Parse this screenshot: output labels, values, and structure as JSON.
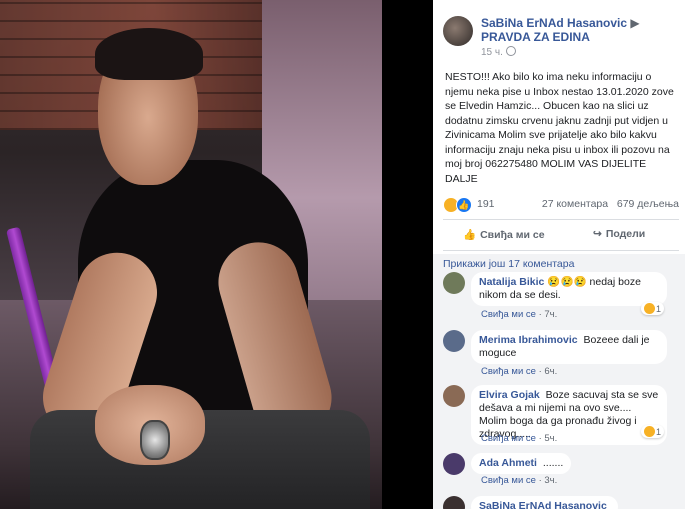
{
  "post": {
    "author": "SaBiNa ErNAd Hasanovic",
    "arrow": "▶",
    "target": "PRAVDA ZA EDINA",
    "time": "15 ч.",
    "text": "NESTO!!! Ako bilo ko ima neku informaciju o njemu neka pise u Inbox nestao 13.01.2020 zove se Elvedin Hamzic... Obucen kao na slici uz dodatnu zimsku crvenu jaknu zadnji put vidjen u Zivinicama Molim sve prijatelje ako bilo kakvu informaciju znaju neka pisu u inbox ili pozovu na moj broj 062275480 MOLIM VAS DIJELITE DALJE"
  },
  "reactions": {
    "count": "191",
    "comments": "27 коментара",
    "shares": "679 дељења"
  },
  "actions": {
    "like": "Свиђа ми се",
    "share": "Подели",
    "like_icon": "thumbs-up-icon",
    "share_icon": "share-arrow-icon"
  },
  "comments_section": {
    "more": "Прикажи још 17 коментара",
    "like_label": "Свиђа ми се",
    "items": [
      {
        "name": "Natalija Bikic",
        "text": "nedaj boze nikom da se desi.",
        "prefix_emoji": "😢😢😢",
        "time": "7ч.",
        "reaction_count": "1",
        "avatar_color": "#6f7a5a"
      },
      {
        "name": "Merima Ibrahimovic",
        "text": "Bozeee dali je moguce",
        "prefix_emoji": "",
        "time": "6ч.",
        "reaction_count": "",
        "avatar_color": "#5a6b8a"
      },
      {
        "name": "Elvira Gojak",
        "text": "Boze sacuvaj sta se sve dešava a mi nijemi na ovo sve.... Molim boga da ga pronađu živog i zdravog.....",
        "prefix_emoji": "",
        "time": "5ч.",
        "reaction_count": "1",
        "avatar_color": "#8a6a55"
      },
      {
        "name": "Ada Ahmeti",
        "text": ".......",
        "prefix_emoji": "",
        "time": "3ч.",
        "reaction_count": "",
        "avatar_color": "#4a3a6a"
      },
      {
        "name": "SaBiNa ErNAd Hasanovic",
        "text": "",
        "prefix_emoji": "",
        "time": "",
        "reaction_count": "",
        "avatar_color": "#3a3030"
      }
    ]
  }
}
